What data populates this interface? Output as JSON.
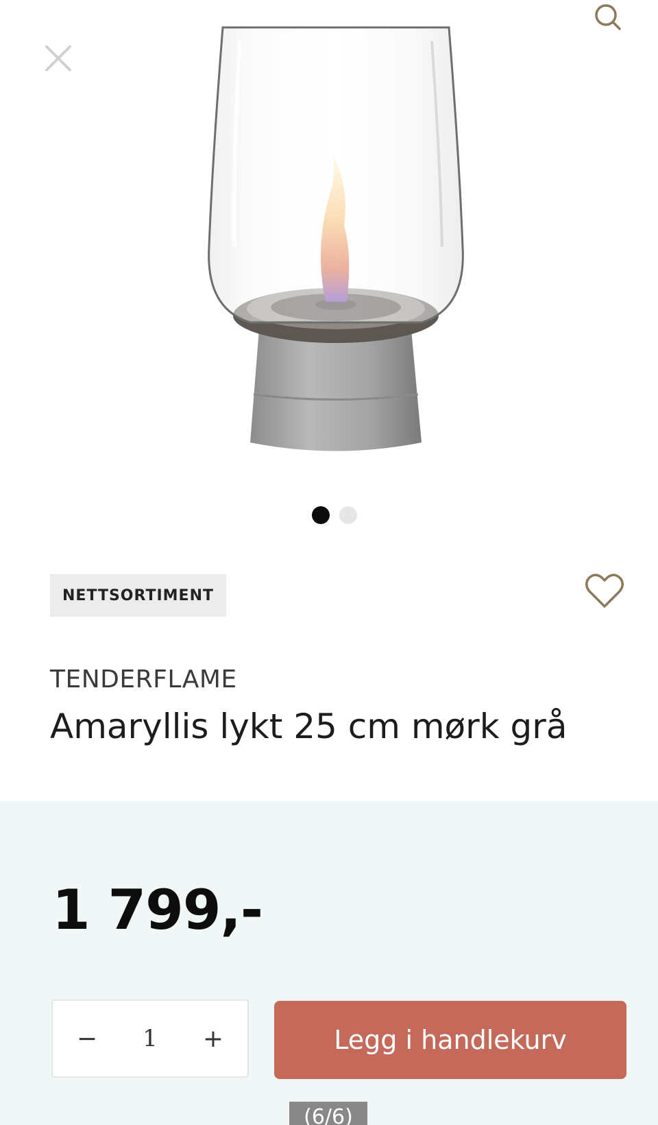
{
  "header": {
    "close_icon": "close-icon",
    "search_icon": "search-icon"
  },
  "gallery": {
    "image_alt": "Amaryllis lykt 25 cm mørk grå",
    "slide_count": 2,
    "active_slide": 1
  },
  "product": {
    "badge": "NETTSORTIMENT",
    "brand": "TENDERFLAME",
    "title": "Amaryllis lykt 25 cm mørk grå",
    "favorite_icon": "heart-icon"
  },
  "purchase": {
    "price": "1 799,-",
    "quantity": "1",
    "decrement_label": "−",
    "increment_label": "+",
    "add_to_cart_label": "Legg i handlekurv"
  },
  "overlay": {
    "counter": "(6/6)"
  },
  "colors": {
    "accent_button": "#c56a5b",
    "panel_background": "#f1f7f6",
    "badge_background": "#ececec",
    "active_dot": "#0b0b0b",
    "inactive_dot": "#e6e6e6"
  }
}
